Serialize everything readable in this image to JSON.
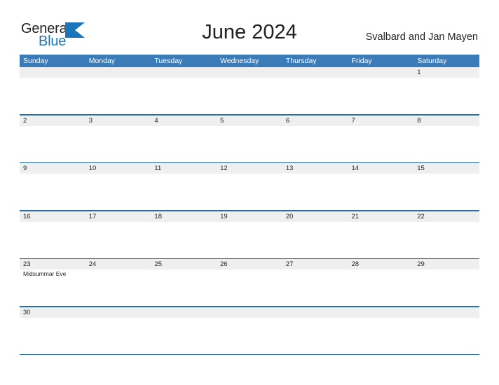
{
  "brand": {
    "name_part1": "General",
    "name_part2": "Blue",
    "accent_color": "#1b75bb",
    "logo_icon": "triangle-flag-icon"
  },
  "header": {
    "title": "June 2024",
    "subtitle": "Svalbard and Jan Mayen"
  },
  "colors": {
    "header_blue": "#3b7cb8",
    "separator_blue": "#2a6ca8",
    "number_band_gray": "#efefef",
    "text": "#231f20"
  },
  "calendar": {
    "day_headers": [
      "Sunday",
      "Monday",
      "Tuesday",
      "Wednesday",
      "Thursday",
      "Friday",
      "Saturday"
    ],
    "weeks": [
      {
        "days": [
          {
            "num": "",
            "events": []
          },
          {
            "num": "",
            "events": []
          },
          {
            "num": "",
            "events": []
          },
          {
            "num": "",
            "events": []
          },
          {
            "num": "",
            "events": []
          },
          {
            "num": "",
            "events": []
          },
          {
            "num": "1",
            "events": []
          }
        ]
      },
      {
        "days": [
          {
            "num": "2",
            "events": []
          },
          {
            "num": "3",
            "events": []
          },
          {
            "num": "4",
            "events": []
          },
          {
            "num": "5",
            "events": []
          },
          {
            "num": "6",
            "events": []
          },
          {
            "num": "7",
            "events": []
          },
          {
            "num": "8",
            "events": []
          }
        ]
      },
      {
        "days": [
          {
            "num": "9",
            "events": []
          },
          {
            "num": "10",
            "events": []
          },
          {
            "num": "11",
            "events": []
          },
          {
            "num": "12",
            "events": []
          },
          {
            "num": "13",
            "events": []
          },
          {
            "num": "14",
            "events": []
          },
          {
            "num": "15",
            "events": []
          }
        ]
      },
      {
        "days": [
          {
            "num": "16",
            "events": []
          },
          {
            "num": "17",
            "events": []
          },
          {
            "num": "18",
            "events": []
          },
          {
            "num": "19",
            "events": []
          },
          {
            "num": "20",
            "events": []
          },
          {
            "num": "21",
            "events": []
          },
          {
            "num": "22",
            "events": []
          }
        ]
      },
      {
        "days": [
          {
            "num": "23",
            "events": [
              "Midsummar Eve"
            ]
          },
          {
            "num": "24",
            "events": []
          },
          {
            "num": "25",
            "events": []
          },
          {
            "num": "26",
            "events": []
          },
          {
            "num": "27",
            "events": []
          },
          {
            "num": "28",
            "events": []
          },
          {
            "num": "29",
            "events": []
          }
        ]
      },
      {
        "days": [
          {
            "num": "30",
            "events": []
          },
          {
            "num": "",
            "events": []
          },
          {
            "num": "",
            "events": []
          },
          {
            "num": "",
            "events": []
          },
          {
            "num": "",
            "events": []
          },
          {
            "num": "",
            "events": []
          },
          {
            "num": "",
            "events": []
          }
        ]
      }
    ]
  }
}
